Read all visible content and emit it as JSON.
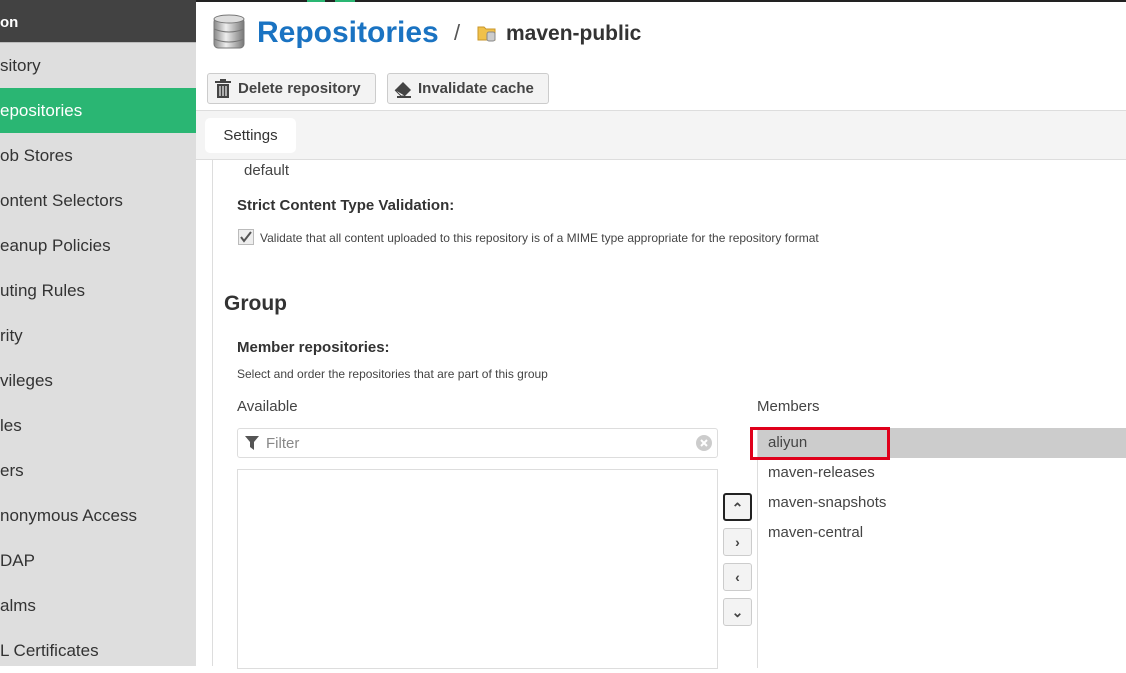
{
  "sidebar": {
    "header": "on",
    "items": [
      {
        "label": "sitory"
      },
      {
        "label": "epositories",
        "active": true
      },
      {
        "label": "ob Stores"
      },
      {
        "label": "ontent Selectors"
      },
      {
        "label": "eanup Policies"
      },
      {
        "label": "uting Rules"
      },
      {
        "label": "rity"
      },
      {
        "label": "vileges"
      },
      {
        "label": "les"
      },
      {
        "label": "ers"
      },
      {
        "label": "nonymous Access"
      },
      {
        "label": "DAP"
      },
      {
        "label": "alms"
      },
      {
        "label": "L Certificates"
      }
    ]
  },
  "header": {
    "title": "Repositories",
    "separator": "/",
    "repo": "maven-public",
    "delete_label": "Delete repository",
    "invalidate_label": "Invalidate cache"
  },
  "tabs": [
    {
      "label": "Settings"
    }
  ],
  "form": {
    "blob_value": "default",
    "strict_label": "Strict Content Type Validation:",
    "strict_checkbox_label": "Validate that all content uploaded to this repository is of a MIME type appropriate for the repository format",
    "strict_checked": true,
    "group_heading": "Group",
    "members_label": "Member repositories:",
    "members_help": "Select and order the repositories that are part of this group",
    "available_label": "Available",
    "filter_placeholder": "Filter",
    "members_list_label": "Members",
    "members": [
      "aliyun",
      "maven-releases",
      "maven-snapshots",
      "maven-central"
    ],
    "selected_member": "aliyun"
  },
  "colors": {
    "accent": "#2ab673",
    "title": "#1a73c2",
    "highlight": "#e0001b"
  }
}
